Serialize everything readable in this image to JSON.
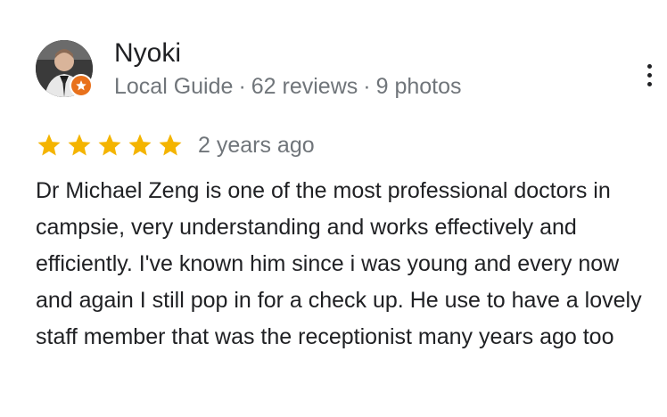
{
  "reviewer": {
    "name": "Nyoki",
    "role": "Local Guide",
    "separator": "·",
    "reviews": "62 reviews",
    "photos": "9 photos",
    "avatar_icon": "user-photo",
    "badge_icon": "local-guide-star-badge",
    "badge_color": "#e8711c"
  },
  "rating": {
    "stars": 5,
    "max_stars": 5,
    "star_color": "#f4b400",
    "time_ago": "2 years ago"
  },
  "review": {
    "text": "Dr Michael Zeng is one of the most professional doctors in campsie, very understanding and works effectively and efficiently. I've known him since i was young and every now and again I still pop in for a check up. He use to have a lovely staff member that was the receptionist many years ago too"
  },
  "menu": {
    "icon": "more-vert-icon"
  }
}
